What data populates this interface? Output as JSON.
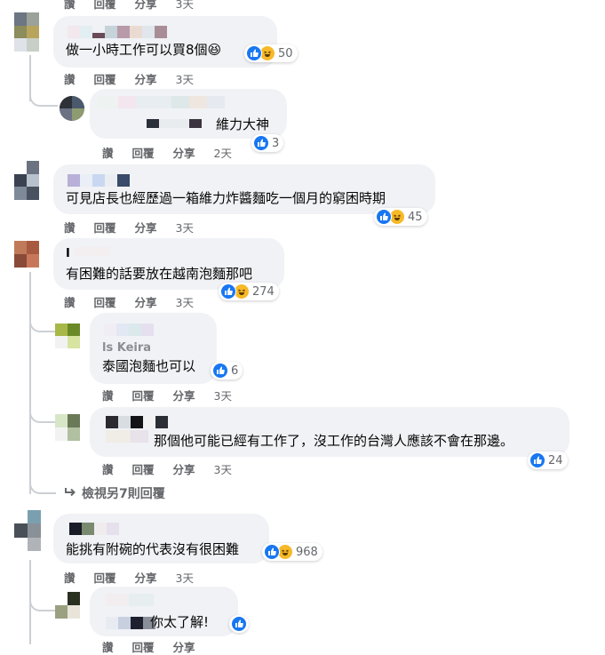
{
  "actions": {
    "like": "讚",
    "reply": "回覆",
    "share": "分享"
  },
  "comments": [
    {
      "text": "做一小時工作可以買8個😆",
      "time": "3天",
      "reactions": "50"
    },
    {
      "text": "維力大神",
      "time": "2天",
      "reactions": "3"
    },
    {
      "text": "可見店長也經歷過一箱維力炸醬麵吃一個月的窮困時期",
      "time": "3天",
      "reactions": "45"
    },
    {
      "name": "I",
      "text": "有困難的話要放在越南泡麵那吧",
      "time": "3天",
      "reactions": "274"
    },
    {
      "name": "ls Keira",
      "text": "泰國泡麵也可以",
      "time": "3天",
      "reactions": "6"
    },
    {
      "text": "那個他可能已經有工作了，沒工作的台灣人應該不會在那邊。",
      "time": "3天",
      "reactions": "24"
    },
    {
      "text": "能挑有附碗的代表沒有很困難",
      "time": "3天",
      "reactions": "968"
    },
    {
      "text": "你太了解!",
      "time": "",
      "reactions": ""
    }
  ],
  "top_partial": {
    "time": "3天"
  },
  "view_more": "檢視另7則回覆",
  "colors": {
    "bubble": "#f0f2f5",
    "like_blue": "#1877f2",
    "haha_yellow": "#f7b928",
    "meta_gray": "#65676b"
  }
}
